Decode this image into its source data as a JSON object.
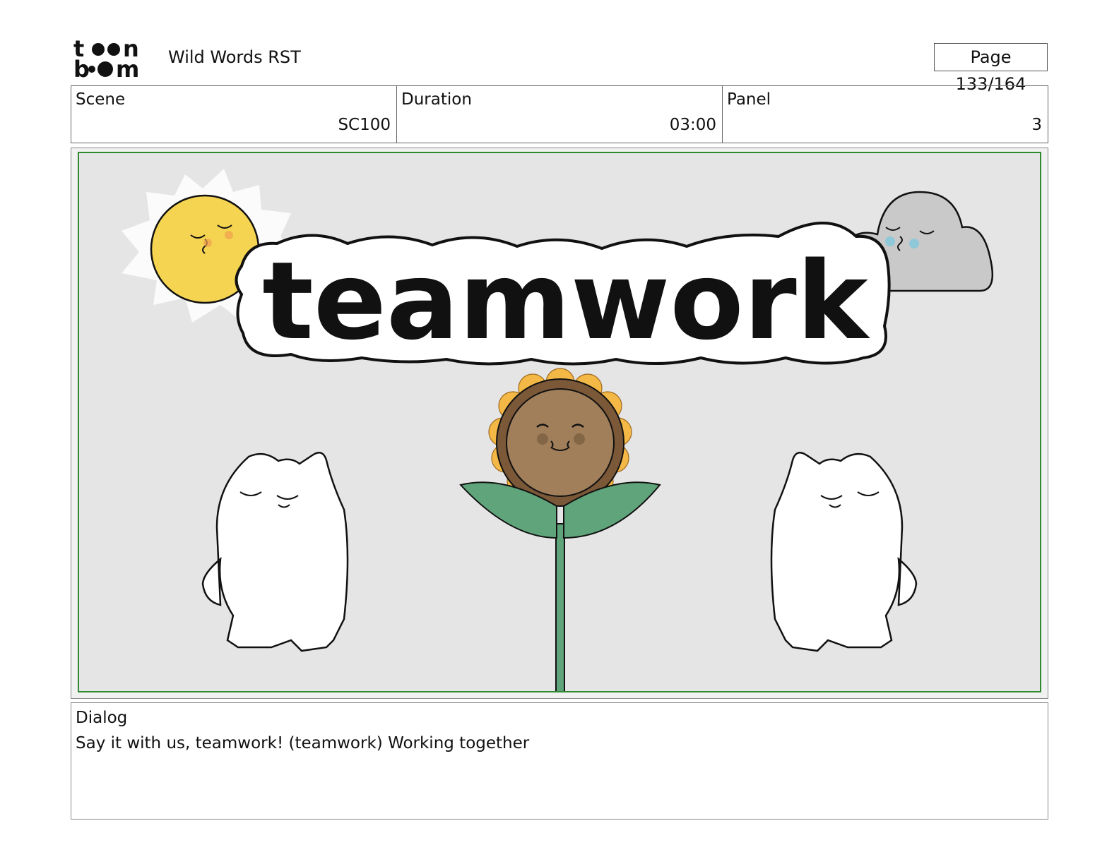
{
  "header": {
    "logo_text": "toon boom",
    "project_title": "Wild Words RST",
    "page_indicator": "Page 133/164"
  },
  "info": {
    "scene": {
      "label": "Scene",
      "value": "SC100"
    },
    "duration": {
      "label": "Duration",
      "value": "03:00"
    },
    "panel": {
      "label": "Panel",
      "value": "3"
    }
  },
  "artwork": {
    "word": "teamwork",
    "colors": {
      "background": "#e5e5e5",
      "frame_border": "#2f8a2f",
      "sun": "#f5d451",
      "cloud": "#c9c9c9",
      "petals": "#f3b845",
      "flower_center": "#a07f5a",
      "leaves": "#5fa47a"
    }
  },
  "dialog": {
    "label": "Dialog",
    "text": "Say it with us, teamwork! (teamwork) Working together"
  }
}
